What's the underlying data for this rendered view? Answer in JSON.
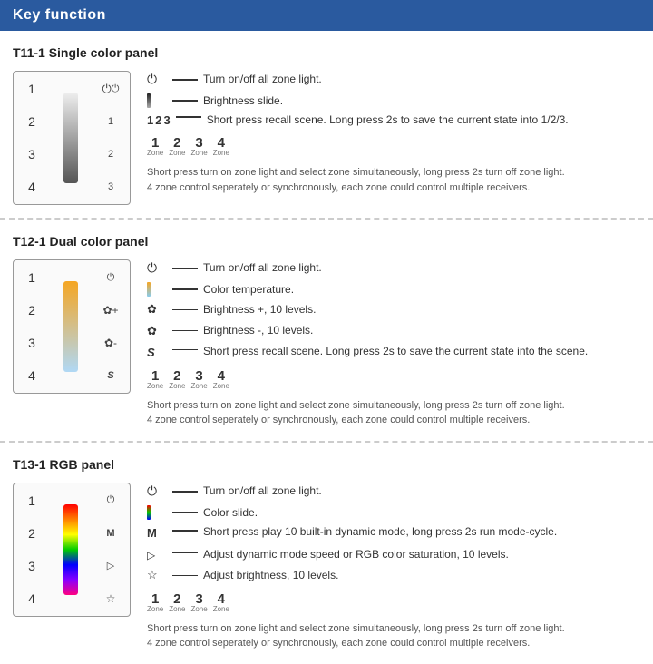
{
  "header": {
    "title": "Key function"
  },
  "sections": [
    {
      "id": "t11",
      "title": "T11-1  Single color panel",
      "slider_type": "gray",
      "zones": [
        "1",
        "2",
        "3",
        "4"
      ],
      "panel_buttons": [
        "power",
        "1",
        "2",
        "3"
      ],
      "desc_rows": [
        {
          "icon": "power",
          "line": true,
          "text": "Turn on/off all zone light."
        },
        {
          "icon": "brightness_bar",
          "line": true,
          "text": "Brightness slide."
        },
        {
          "icon": "scene_123",
          "line": true,
          "text": "Short press recall scene. Long press 2s to save the current state into 1/2/3."
        },
        {
          "icon": "zone_1234",
          "line": false,
          "text": ""
        },
        {
          "icon": "none",
          "line": false,
          "text": "Short press turn on zone light and select zone simultaneously, long press 2s turn off zone light. 4 zone control seperately or synchronously, each zone could control multiple receivers."
        }
      ]
    },
    {
      "id": "t12",
      "title": "T12-1  Dual color panel",
      "slider_type": "dual",
      "zones": [
        "1",
        "2",
        "3",
        "4"
      ],
      "panel_buttons": [
        "power",
        "sun_up",
        "sun_down",
        "s"
      ],
      "desc_rows": [
        {
          "icon": "power",
          "line": true,
          "text": "Turn on/off all zone light."
        },
        {
          "icon": "color_bar",
          "line": true,
          "text": "Color temperature."
        },
        {
          "icon": "sun_plus",
          "line": true,
          "text": "Brightness +, 10 levels."
        },
        {
          "icon": "sun_minus",
          "line": true,
          "text": "Brightness -, 10 levels."
        },
        {
          "icon": "s_key",
          "line": true,
          "text": "Short press recall scene. Long press 2s to save the current state into the scene."
        },
        {
          "icon": "zone_1234",
          "line": false,
          "text": ""
        },
        {
          "icon": "none",
          "line": false,
          "text": "Short press turn on zone light and select zone simultaneously, long press 2s turn off zone light. 4 zone control seperately or synchronously, each zone could control multiple receivers."
        }
      ]
    },
    {
      "id": "t13",
      "title": "T13-1  RGB panel",
      "slider_type": "rgb",
      "zones": [
        "1",
        "2",
        "3",
        "4"
      ],
      "panel_buttons": [
        "power",
        "m",
        "play",
        "bright"
      ],
      "desc_rows": [
        {
          "icon": "power",
          "line": true,
          "text": "Turn on/off all zone light."
        },
        {
          "icon": "rgb_bar",
          "line": true,
          "text": "Color slide."
        },
        {
          "icon": "m_key",
          "line": true,
          "text": "Short press play 10 built-in dynamic mode, long press 2s run mode-cycle."
        },
        {
          "icon": "speed",
          "line": true,
          "text": "Adjust dynamic mode speed or RGB color saturation, 10 levels."
        },
        {
          "icon": "sun_bright",
          "line": true,
          "text": "Adjust brightness, 10 levels."
        },
        {
          "icon": "zone_1234",
          "line": false,
          "text": ""
        },
        {
          "icon": "none",
          "line": false,
          "text": "Short press turn on zone light and select zone simultaneously, long press 2s turn off zone light. 4 zone control seperately or synchronously, each zone could control multiple receivers."
        }
      ]
    }
  ]
}
